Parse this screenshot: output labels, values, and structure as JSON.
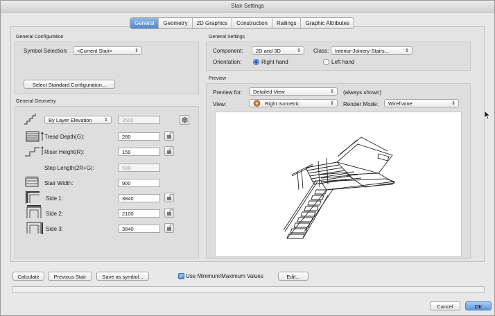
{
  "window": {
    "title": "Stair Settings"
  },
  "tabs": [
    {
      "label": "General",
      "active": true
    },
    {
      "label": "Geometry",
      "active": false
    },
    {
      "label": "2D Graphics",
      "active": false
    },
    {
      "label": "Construction",
      "active": false
    },
    {
      "label": "Railings",
      "active": false
    },
    {
      "label": "Graphic Attributes",
      "active": false
    }
  ],
  "general_configuration": {
    "title": "General Configuration",
    "symbol_selection_label": "Symbol Selection:",
    "symbol_selection_value": "<Current Stair>",
    "select_standard_button": "Select Standard Configuration..."
  },
  "general_settings": {
    "title": "General Settings",
    "component_label": "Component:",
    "component_value": "2D and 3D",
    "class_label": "Class:",
    "class_value": "Interior-Joinery-Stairs...",
    "orientation_label": "Orientation:",
    "orientation_right": "Right hand",
    "orientation_left": "Left hand",
    "orientation_selected": "Right hand"
  },
  "general_geometry": {
    "title": "General Geometry",
    "elevation_mode": "By Layer Elevation",
    "elevation_value": "3500",
    "tread_depth_label": "Tread Depth(G):",
    "tread_depth_value": "280",
    "riser_height_label": "Riser Height(R):",
    "riser_height_value": "159",
    "step_length_label": "Step Length(2R+G):",
    "step_length_value": "598",
    "stair_width_label": "Stair Width:",
    "stair_width_value": "900",
    "side1_label": "Side 1:",
    "side1_value": "3840",
    "side2_label": "Side 2:",
    "side2_value": "2100",
    "side3_label": "Side 3:",
    "side3_value": "3840"
  },
  "preview": {
    "title": "Preview",
    "preview_for_label": "Preview for:",
    "preview_for_value": "Detailed View",
    "always_shown": "(always shown)",
    "view_label": "View:",
    "view_value": "Right Isometric",
    "render_mode_label": "Render Mode:",
    "render_mode_value": "Wireframe"
  },
  "bottom": {
    "calculate": "Calculate",
    "previous_stair": "Previous Stair",
    "save_as_symbol": "Save as symbol...",
    "use_min_max_label": "Use Minimum/Maximum Values",
    "use_min_max_checked": true,
    "edit": "Edit...",
    "cancel": "Cancel",
    "ok": "OK"
  },
  "icons": {
    "lock": "lock-icon",
    "view_cube": "view-cube-icon",
    "elevation": "stair-elevation-icon",
    "tread": "tread-depth-icon",
    "riser": "riser-height-icon",
    "width": "stair-width-icon",
    "sides": "stair-side-icon"
  },
  "colors": {
    "accent": "#4f88d0",
    "panel": "#e4e4e4"
  }
}
